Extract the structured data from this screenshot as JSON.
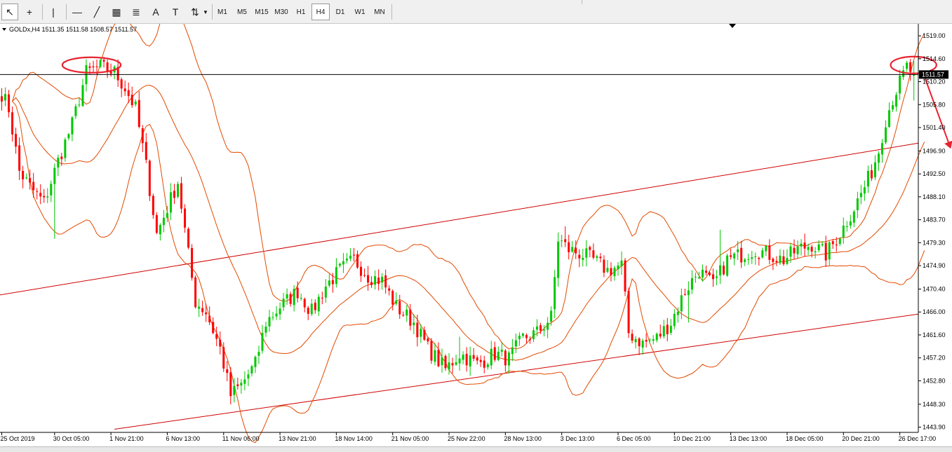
{
  "toolbar": {
    "tools": [
      {
        "name": "cursor-icon",
        "glyph": "↖",
        "active": true
      },
      {
        "name": "crosshair-icon",
        "glyph": "+",
        "active": false
      },
      {
        "name": "vertical-line-icon",
        "glyph": "|",
        "active": false
      },
      {
        "name": "horizontal-line-icon",
        "glyph": "—",
        "active": false
      },
      {
        "name": "trendline-icon",
        "glyph": "╱",
        "active": false
      },
      {
        "name": "equidistant-channel-icon",
        "glyph": "▦",
        "active": false
      },
      {
        "name": "fibonacci-icon",
        "glyph": "≣",
        "active": false
      },
      {
        "name": "text-icon",
        "glyph": "A",
        "active": false
      },
      {
        "name": "text-label-icon",
        "glyph": "T",
        "active": false
      },
      {
        "name": "arrows-icon",
        "glyph": "⇅",
        "active": false
      }
    ],
    "timeframes": [
      "M1",
      "M5",
      "M15",
      "M30",
      "H1",
      "H4",
      "D1",
      "W1",
      "MN"
    ],
    "active_timeframe": "H4"
  },
  "header": {
    "symbol_line": "GOLDx,H4  1511.35 1511.58 1508.57 1511.57"
  },
  "colors": {
    "bull": "#00c800",
    "bear": "#ff0000",
    "bands": "#e24a00",
    "channel": "#d00000",
    "annotation": "#e8232f"
  },
  "chart_data": {
    "type": "candlestick",
    "symbol": "GOLDx",
    "timeframe": "H4",
    "ohlc_last": {
      "open": 1511.35,
      "high": 1511.58,
      "low": 1508.57,
      "close": 1511.57
    },
    "current_price": 1511.57,
    "current_price_label": "1511.57",
    "y_ticks": [
      "1519.00",
      "1514.60",
      "1510.20",
      "1505.80",
      "1501.40",
      "1496.90",
      "1492.50",
      "1488.10",
      "1483.70",
      "1479.30",
      "1474.90",
      "1470.40",
      "1466.00",
      "1461.60",
      "1457.20",
      "1452.80",
      "1448.30",
      "1443.90"
    ],
    "ylim": [
      1442.9,
      1521.3
    ],
    "x_labels": [
      "25 Oct 2019",
      "30 Oct 05:00",
      "1 Nov 21:00",
      "6 Nov 13:00",
      "11 Nov 06:00",
      "13 Nov 21:00",
      "18 Nov 14:00",
      "21 Nov 05:00",
      "25 Nov 22:00",
      "28 Nov 13:00",
      "3 Dec 13:00",
      "6 Dec 05:00",
      "10 Dec 21:00",
      "13 Dec 13:00",
      "18 Dec 05:00",
      "20 Dec 21:00",
      "26 Dec 17:00"
    ],
    "x_label_slots": [
      0,
      15,
      31,
      47,
      63,
      79,
      95,
      111,
      127,
      143,
      159,
      175,
      191,
      207,
      223,
      239,
      255
    ],
    "slot_count": 274,
    "close_anchors": [
      [
        0,
        1508
      ],
      [
        2,
        1505
      ],
      [
        5,
        1493
      ],
      [
        8,
        1490
      ],
      [
        12,
        1487
      ],
      [
        16,
        1495
      ],
      [
        20,
        1502
      ],
      [
        24,
        1512
      ],
      [
        28,
        1513
      ],
      [
        32,
        1512
      ],
      [
        35,
        1509
      ],
      [
        38,
        1505
      ],
      [
        41,
        1494
      ],
      [
        44,
        1481
      ],
      [
        47,
        1486
      ],
      [
        50,
        1491
      ],
      [
        53,
        1477
      ],
      [
        55,
        1468
      ],
      [
        58,
        1466
      ],
      [
        62,
        1459
      ],
      [
        65,
        1450
      ],
      [
        68,
        1452
      ],
      [
        72,
        1456
      ],
      [
        75,
        1464
      ],
      [
        79,
        1467
      ],
      [
        84,
        1470
      ],
      [
        88,
        1466
      ],
      [
        92,
        1471
      ],
      [
        96,
        1474
      ],
      [
        100,
        1476
      ],
      [
        104,
        1473
      ],
      [
        108,
        1472
      ],
      [
        112,
        1467
      ],
      [
        117,
        1464
      ],
      [
        121,
        1459
      ],
      [
        126,
        1455
      ],
      [
        130,
        1458
      ],
      [
        135,
        1456
      ],
      [
        140,
        1458
      ],
      [
        144,
        1457
      ],
      [
        148,
        1461
      ],
      [
        152,
        1462
      ],
      [
        156,
        1465
      ],
      [
        158,
        1480
      ],
      [
        161,
        1478
      ],
      [
        165,
        1477
      ],
      [
        168,
        1476
      ],
      [
        172,
        1474
      ],
      [
        176,
        1475
      ],
      [
        178,
        1462
      ],
      [
        182,
        1460
      ],
      [
        186,
        1461
      ],
      [
        190,
        1464
      ],
      [
        194,
        1470
      ],
      [
        198,
        1474
      ],
      [
        202,
        1471
      ],
      [
        206,
        1476
      ],
      [
        210,
        1477
      ],
      [
        214,
        1478
      ],
      [
        218,
        1477
      ],
      [
        222,
        1476
      ],
      [
        226,
        1478
      ],
      [
        230,
        1479
      ],
      [
        234,
        1477
      ],
      [
        238,
        1481
      ],
      [
        242,
        1486
      ],
      [
        245,
        1490
      ],
      [
        247,
        1493
      ],
      [
        249,
        1497
      ],
      [
        251,
        1503
      ],
      [
        253,
        1507
      ],
      [
        255,
        1510
      ],
      [
        257,
        1513
      ],
      [
        259,
        1511.57
      ]
    ],
    "bollinger": {
      "period": 20,
      "deviations": 2
    },
    "channel_lines": [
      {
        "name": "upper-channel",
        "points": [
          [
            -3,
            1469
          ],
          [
            274,
            1498.4
          ]
        ]
      },
      {
        "name": "lower-channel",
        "points": [
          [
            32,
            1443.5
          ],
          [
            274,
            1465.6
          ]
        ]
      }
    ],
    "grid": false
  },
  "annotations": [
    {
      "type": "ellipse",
      "name": "top-left-ellipse"
    },
    {
      "type": "ellipse",
      "name": "top-right-ellipse"
    },
    {
      "type": "arrow",
      "name": "down-arrow"
    }
  ]
}
